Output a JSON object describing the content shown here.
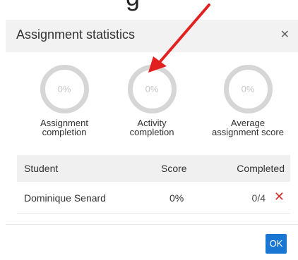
{
  "top_partial_text": "g",
  "dialog": {
    "title": "Assignment statistics",
    "close_icon": "close-icon"
  },
  "stats": [
    {
      "value": "0%",
      "label_line1": "Assignment",
      "label_line2": "completion"
    },
    {
      "value": "0%",
      "label_line1": "Activity",
      "label_line2": "completion"
    },
    {
      "value": "0%",
      "label_line1": "Average",
      "label_line2": "assignment score"
    }
  ],
  "table": {
    "headers": {
      "student": "Student",
      "score": "Score",
      "completed": "Completed"
    },
    "rows": [
      {
        "student": "Dominique Senard",
        "score": "0%",
        "completed": "0/4",
        "status_icon": "x-icon"
      }
    ]
  },
  "footer": {
    "ok_label": "OK"
  },
  "colors": {
    "accent": "#1976d2",
    "error": "#d32f2f",
    "annotation_arrow": "#e32020"
  }
}
